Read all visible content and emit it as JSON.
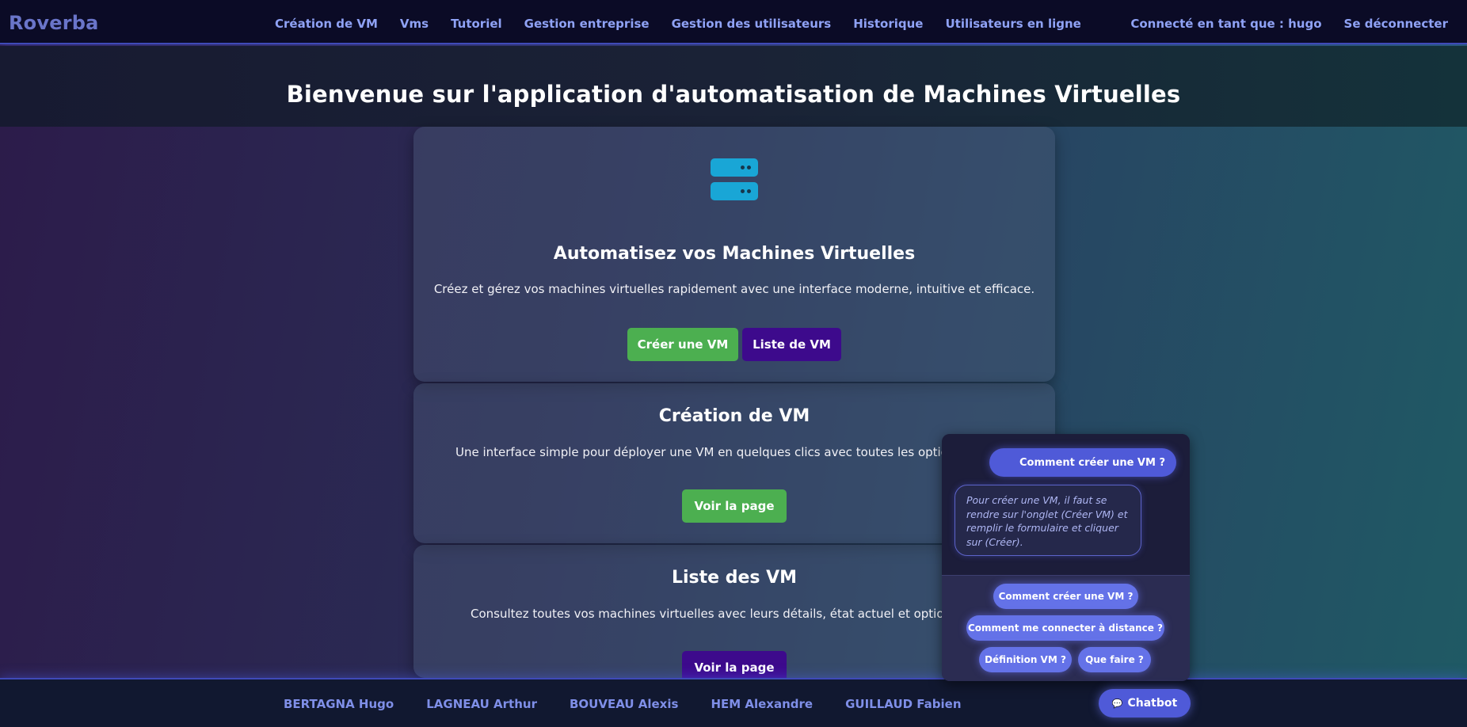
{
  "app": {
    "brand": "Roverba"
  },
  "nav": {
    "links": [
      "Création de VM",
      "Vms",
      "Tutoriel",
      "Gestion entreprise",
      "Gestion des utilisateurs",
      "Historique",
      "Utilisateurs en ligne"
    ],
    "user_label": "Connecté en tant que : hugo",
    "logout_label": "Se déconnecter"
  },
  "hero": {
    "title": "Bienvenue sur l'application d'automatisation de Machines Virtuelles"
  },
  "cards": {
    "main": {
      "icon": "server-icon",
      "title": "Automatisez vos Machines Virtuelles",
      "text": "Créez et gérez vos machines virtuelles rapidement avec une interface moderne, intuitive et efficace.",
      "btn_create": "Créer une VM",
      "btn_list": "Liste de VM"
    },
    "creation": {
      "title": "Création de VM",
      "text": "Une interface simple pour déployer une VM en quelques clics avec toutes les options nécessaires",
      "btn": "Voir la page"
    },
    "list": {
      "title": "Liste des VM",
      "text": "Consultez toutes vos machines virtuelles avec leurs détails, état actuel et options de gestion",
      "btn": "Voir la page"
    }
  },
  "footer": {
    "names": [
      "BERTAGNA Hugo",
      "LAGNEAU Arthur",
      "BOUVEAU Alexis",
      "HEM Alexandre",
      "GUILLAUD Fabien"
    ]
  },
  "chatbot": {
    "toggle_label": "Chatbot",
    "toggle_icon": "chat-bubble-icon",
    "user_message": "Comment créer une VM ?",
    "bot_message": "Pour créer une VM, il faut se rendre sur l'onglet (Créer VM) et remplir le formulaire et cliquer sur (Créer).",
    "options": [
      "Comment créer une VM ?",
      "Comment me connecter à distance ?",
      "Définition VM ?",
      "Que faire ?"
    ]
  },
  "colors": {
    "accent": "#4f5ad8",
    "green": "#4caf50",
    "purple": "#3d0a8c",
    "nav_text": "#8fa2f5",
    "icon": "#19a6d6"
  }
}
